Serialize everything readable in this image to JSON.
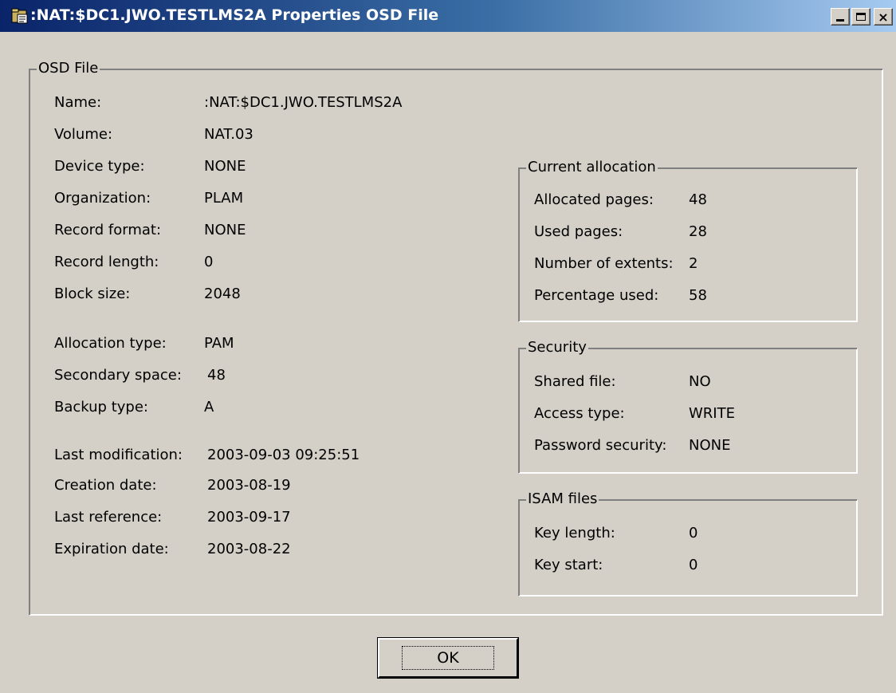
{
  "window": {
    "title": ":NAT:$DC1.JWO.TESTLMS2A Properties OSD File",
    "icon": "folder-file-icon",
    "minimize": "minimize-icon",
    "maximize": "maximize-icon",
    "close_glyph": "×"
  },
  "osd": {
    "legend": "OSD File",
    "fields": [
      {
        "label": "Name:",
        "value": ":NAT:$DC1.JWO.TESTLMS2A"
      },
      {
        "label": "Volume:",
        "value": "NAT.03"
      },
      {
        "label": "Device type:",
        "value": "NONE"
      },
      {
        "label": "Organization:",
        "value": "PLAM"
      },
      {
        "label": "Record format:",
        "value": "NONE"
      },
      {
        "label": "Record length:",
        "value": "0"
      },
      {
        "label": "Block size:",
        "value": "2048"
      },
      {
        "label": "Allocation type:",
        "value": "PAM"
      },
      {
        "label": "Secondary space:",
        "value": "48"
      },
      {
        "label": "Backup type:",
        "value": "A"
      },
      {
        "label": "Last modification:",
        "value": "2003-09-03 09:25:51"
      },
      {
        "label": "Creation date:",
        "value": "2003-08-19"
      },
      {
        "label": "Last reference:",
        "value": "2003-09-17"
      },
      {
        "label": "Expiration date:",
        "value": "2003-08-22"
      }
    ]
  },
  "allocation": {
    "legend": "Current allocation",
    "fields": [
      {
        "label": "Allocated pages:",
        "value": "48"
      },
      {
        "label": "Used pages:",
        "value": "28"
      },
      {
        "label": "Number of extents:",
        "value": "2"
      },
      {
        "label": "Percentage used:",
        "value": "58"
      }
    ]
  },
  "security": {
    "legend": "Security",
    "fields": [
      {
        "label": "Shared file:",
        "value": "NO"
      },
      {
        "label": "Access type:",
        "value": "WRITE"
      },
      {
        "label": "Password security:",
        "value": "NONE"
      }
    ]
  },
  "isam": {
    "legend": "ISAM files",
    "fields": [
      {
        "label": "Key length:",
        "value": "0"
      },
      {
        "label": "Key start:",
        "value": "0"
      }
    ]
  },
  "buttons": {
    "ok": "OK"
  }
}
